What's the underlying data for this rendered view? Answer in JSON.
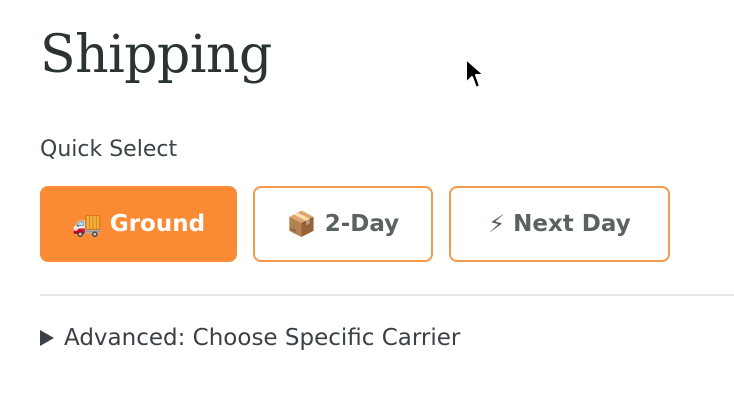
{
  "page": {
    "title": "Shipping"
  },
  "quick_select": {
    "label": "Quick Select",
    "options": [
      {
        "icon": "truck-icon",
        "glyph": "🚚",
        "label": "Ground",
        "selected": true
      },
      {
        "icon": "package-icon",
        "glyph": "📦",
        "label": "2-Day",
        "selected": false
      },
      {
        "icon": "lightning-icon",
        "glyph": "⚡",
        "label": "Next Day",
        "selected": false
      }
    ]
  },
  "advanced": {
    "label": "Advanced: Choose Specific Carrier",
    "expanded": false
  },
  "colors": {
    "accent": "#fb8a35",
    "accent_border": "#f49a4e",
    "text": "#3a4046"
  }
}
